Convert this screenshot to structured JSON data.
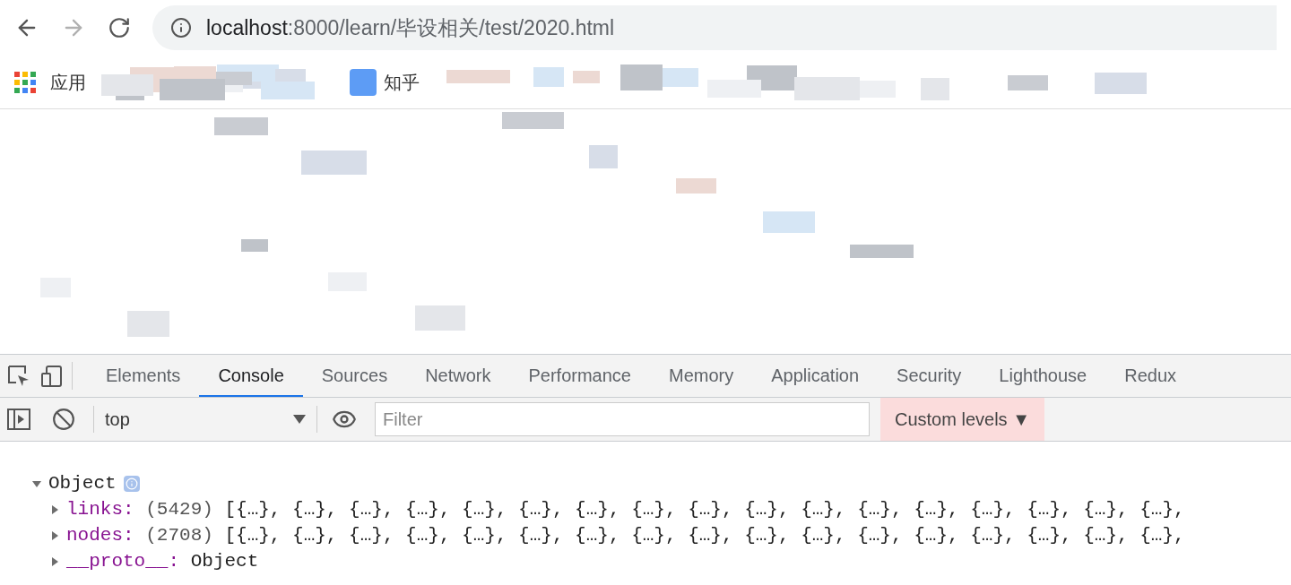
{
  "browser": {
    "url_host": "localhost",
    "url_rest": ":8000/learn/毕设相关/test/2020.html",
    "back_disabled": false,
    "forward_disabled": true
  },
  "bookmarks": [
    {
      "label": "应用",
      "kind": "apps"
    },
    {
      "label": "知乎",
      "kind": "site"
    }
  ],
  "devtools": {
    "tabs": [
      {
        "label": "Elements",
        "selected": false
      },
      {
        "label": "Console",
        "selected": true
      },
      {
        "label": "Sources",
        "selected": false
      },
      {
        "label": "Network",
        "selected": false
      },
      {
        "label": "Performance",
        "selected": false
      },
      {
        "label": "Memory",
        "selected": false
      },
      {
        "label": "Application",
        "selected": false
      },
      {
        "label": "Security",
        "selected": false
      },
      {
        "label": "Lighthouse",
        "selected": false
      },
      {
        "label": "Redux",
        "selected": false
      }
    ],
    "context": "top",
    "filter_placeholder": "Filter",
    "levels": "Custom levels ▼"
  },
  "console": {
    "object_label": "Object",
    "expanded": true,
    "properties": [
      {
        "name": "links:",
        "count": "(5429)",
        "value": "[{…}, {…}, {…}, {…}, {…}, {…}, {…}, {…}, {…}, {…}, {…}, {…}, {…}, {…}, {…}, {…}, {…},",
        "expanded": false
      },
      {
        "name": "nodes:",
        "count": "(2708)",
        "value": "[{…}, {…}, {…}, {…}, {…}, {…}, {…}, {…}, {…}, {…}, {…}, {…}, {…}, {…}, {…}, {…}, {…},",
        "expanded": false
      },
      {
        "name": "__proto__:",
        "value": "Object",
        "expanded": false
      }
    ]
  }
}
